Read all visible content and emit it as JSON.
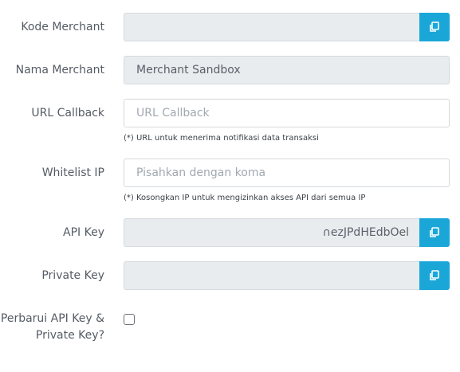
{
  "form": {
    "kode_merchant": {
      "label": "Kode Merchant",
      "value": "",
      "copy_icon": "copy-icon"
    },
    "nama_merchant": {
      "label": "Nama Merchant",
      "value": "Merchant Sandbox"
    },
    "url_callback": {
      "label": "URL Callback",
      "placeholder": "URL Callback",
      "help": "(*) URL untuk menerima notifikasi data transaksi"
    },
    "whitelist_ip": {
      "label": "Whitelist IP",
      "placeholder": "Pisahkan dengan koma",
      "help": "(*) Kosongkan IP untuk mengizinkan akses API dari semua IP"
    },
    "api_key": {
      "label": "API Key",
      "value": "∩ezJPdHEdbOel",
      "copy_icon": "copy-icon"
    },
    "private_key": {
      "label": "Private Key",
      "value": "",
      "copy_icon": "copy-icon"
    },
    "renew": {
      "label_line1": "Perbarui API Key &",
      "label_line2": "Private Key?",
      "checked": false
    }
  },
  "colors": {
    "accent": "#1aa7d8",
    "readonly_bg": "#e9ecef",
    "border": "#d5d9de"
  }
}
